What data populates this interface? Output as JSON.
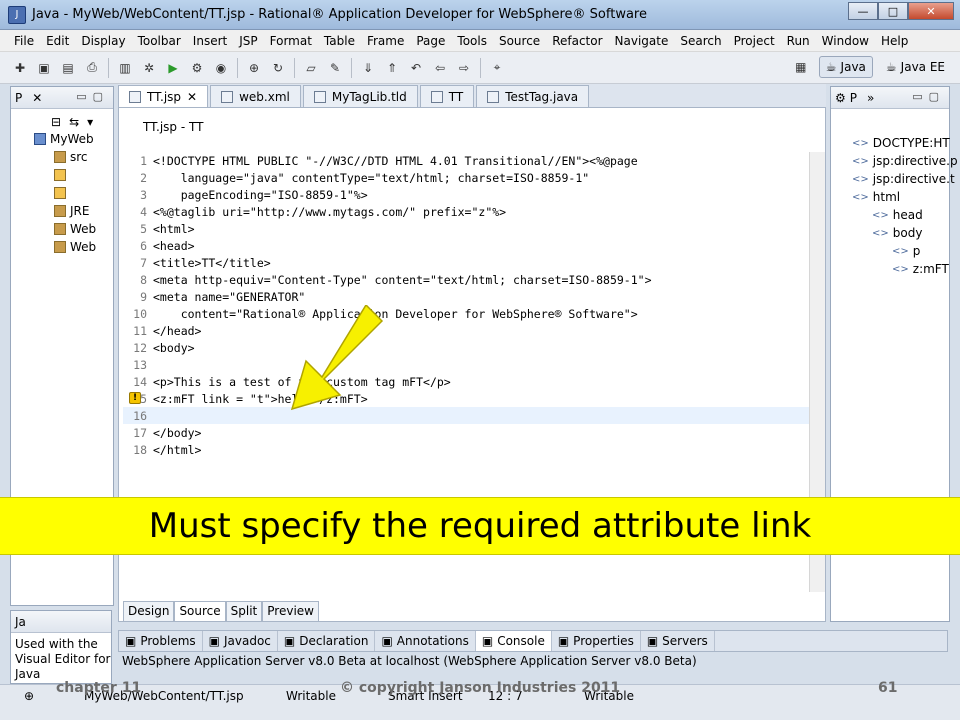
{
  "window": {
    "title": "Java - MyWeb/WebContent/TT.jsp - Rational® Application Developer for WebSphere® Software",
    "minimize": "—",
    "maximize": "□",
    "close": "✕"
  },
  "menu": [
    "File",
    "Edit",
    "Display",
    "Toolbar",
    "Insert",
    "JSP",
    "Format",
    "Table",
    "Frame",
    "Page",
    "Tools",
    "Source",
    "Refactor",
    "Navigate",
    "Search",
    "Project",
    "Run",
    "Window",
    "Help"
  ],
  "perspectives": {
    "java": "Java",
    "javaee": "Java EE"
  },
  "left_pane": {
    "tab_label": "P",
    "tree": [
      {
        "label": "MyWeb",
        "icon": "proj"
      },
      {
        "label": "src",
        "icon": "pkg"
      },
      {
        "label": "",
        "icon": "file"
      },
      {
        "label": "",
        "icon": "file"
      },
      {
        "label": "JRE",
        "icon": "pkg"
      },
      {
        "label": "Web",
        "icon": "pkg"
      },
      {
        "label": "Web",
        "icon": "pkg"
      }
    ]
  },
  "editor": {
    "tabs": [
      "TT.jsp",
      "web.xml",
      "MyTagLib.tld",
      "TT",
      "TestTag.java"
    ],
    "crumb": "TT.jsp - TT",
    "lines": [
      {
        "n": "1",
        "text": "<!DOCTYPE HTML PUBLIC \"-//W3C//DTD HTML 4.01 Transitional//EN\"><%@page"
      },
      {
        "n": "2",
        "text": "    language=\"java\" contentType=\"text/html; charset=ISO-8859-1\""
      },
      {
        "n": "3",
        "text": "    pageEncoding=\"ISO-8859-1\"%>"
      },
      {
        "n": "4",
        "text": "<%@taglib uri=\"http://www.mytags.com/\" prefix=\"z\"%>"
      },
      {
        "n": "5",
        "text": "<html>"
      },
      {
        "n": "6",
        "text": "<head>"
      },
      {
        "n": "7",
        "text": "<title>TT</title>"
      },
      {
        "n": "8",
        "text": "<meta http-equiv=\"Content-Type\" content=\"text/html; charset=ISO-8859-1\">"
      },
      {
        "n": "9",
        "text": "<meta name=\"GENERATOR\""
      },
      {
        "n": "10",
        "text": "    content=\"Rational® Application Developer for WebSphere® Software\">"
      },
      {
        "n": "11",
        "text": "</head>"
      },
      {
        "n": "12",
        "text": "<body>"
      },
      {
        "n": "13",
        "text": ""
      },
      {
        "n": "14",
        "text": "<p>This is a test of the custom tag mFT</p>"
      },
      {
        "n": "15",
        "text": "<z:mFT link = \"t\">hello</z:mFT>"
      },
      {
        "n": "16",
        "text": ""
      },
      {
        "n": "17",
        "text": "</body>"
      },
      {
        "n": "18",
        "text": "</html>"
      }
    ],
    "bottom_tabs": [
      "Design",
      "Source",
      "Split",
      "Preview"
    ]
  },
  "outline": {
    "tab_label": "P",
    "items": [
      "DOCTYPE:HT",
      "jsp:directive.p",
      "jsp:directive.t",
      "html",
      "head",
      "body",
      "p",
      "z:mFT"
    ]
  },
  "bottom_panel": {
    "tabs": [
      "Problems",
      "Javadoc",
      "Declaration",
      "Annotations",
      "Console",
      "Properties",
      "Servers"
    ],
    "console_text": "WebSphere Application Server v8.0 Beta at localhost (WebSphere Application Server v8.0 Beta)"
  },
  "left_bottom": {
    "tab_label": "Ja",
    "text": "Used with the Visual Editor for Java"
  },
  "statusbar": {
    "path": "MyWeb/WebContent/TT.jsp",
    "writable": "Writable",
    "insert": "Smart Insert",
    "position": "12 : 7",
    "writable2": "Writable"
  },
  "footer": {
    "chapter": "chapter 11",
    "copyright": "© copyright Janson Industries 2011",
    "page": "61"
  },
  "banner": {
    "text": "Must specify the required attribute link"
  },
  "colors": {
    "banner": "#ffff00",
    "arrow": "#f7f000"
  }
}
